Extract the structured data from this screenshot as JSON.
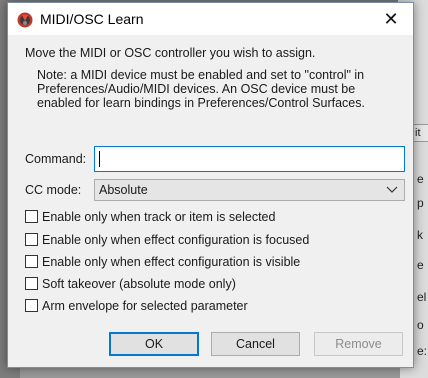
{
  "window": {
    "title": "MIDI/OSC Learn",
    "close_glyph": "✕"
  },
  "dialog": {
    "instruction": "Move the MIDI or OSC controller you wish to assign.",
    "note_lines": [
      "Note: a MIDI device must be enabled and set to \"control\" in",
      "Preferences/Audio/MIDI devices. An OSC device must be",
      "enabled for learn bindings in Preferences/Control Surfaces."
    ],
    "command_label": "Command:",
    "command_value": "",
    "cc_mode_label": "CC mode:",
    "cc_mode_value": "Absolute",
    "checkboxes": [
      {
        "label": "Enable only when track or item is selected",
        "checked": false
      },
      {
        "label": "Enable only when effect configuration is focused",
        "checked": false
      },
      {
        "label": "Enable only when effect configuration is visible",
        "checked": false
      },
      {
        "label": "Soft takeover (absolute mode only)",
        "checked": false
      },
      {
        "label": "Arm envelope for selected parameter",
        "checked": false
      }
    ],
    "buttons": {
      "ok": "OK",
      "cancel": "Cancel",
      "remove": "Remove"
    }
  },
  "background": {
    "right_fragments": [
      "e",
      "p",
      "k",
      "e",
      "el",
      "o",
      "e:"
    ],
    "right_tab": "it"
  },
  "colors": {
    "accent": "#0078d7",
    "dialog_bg": "#f0f0f0",
    "icon_red": "#c0392b"
  }
}
